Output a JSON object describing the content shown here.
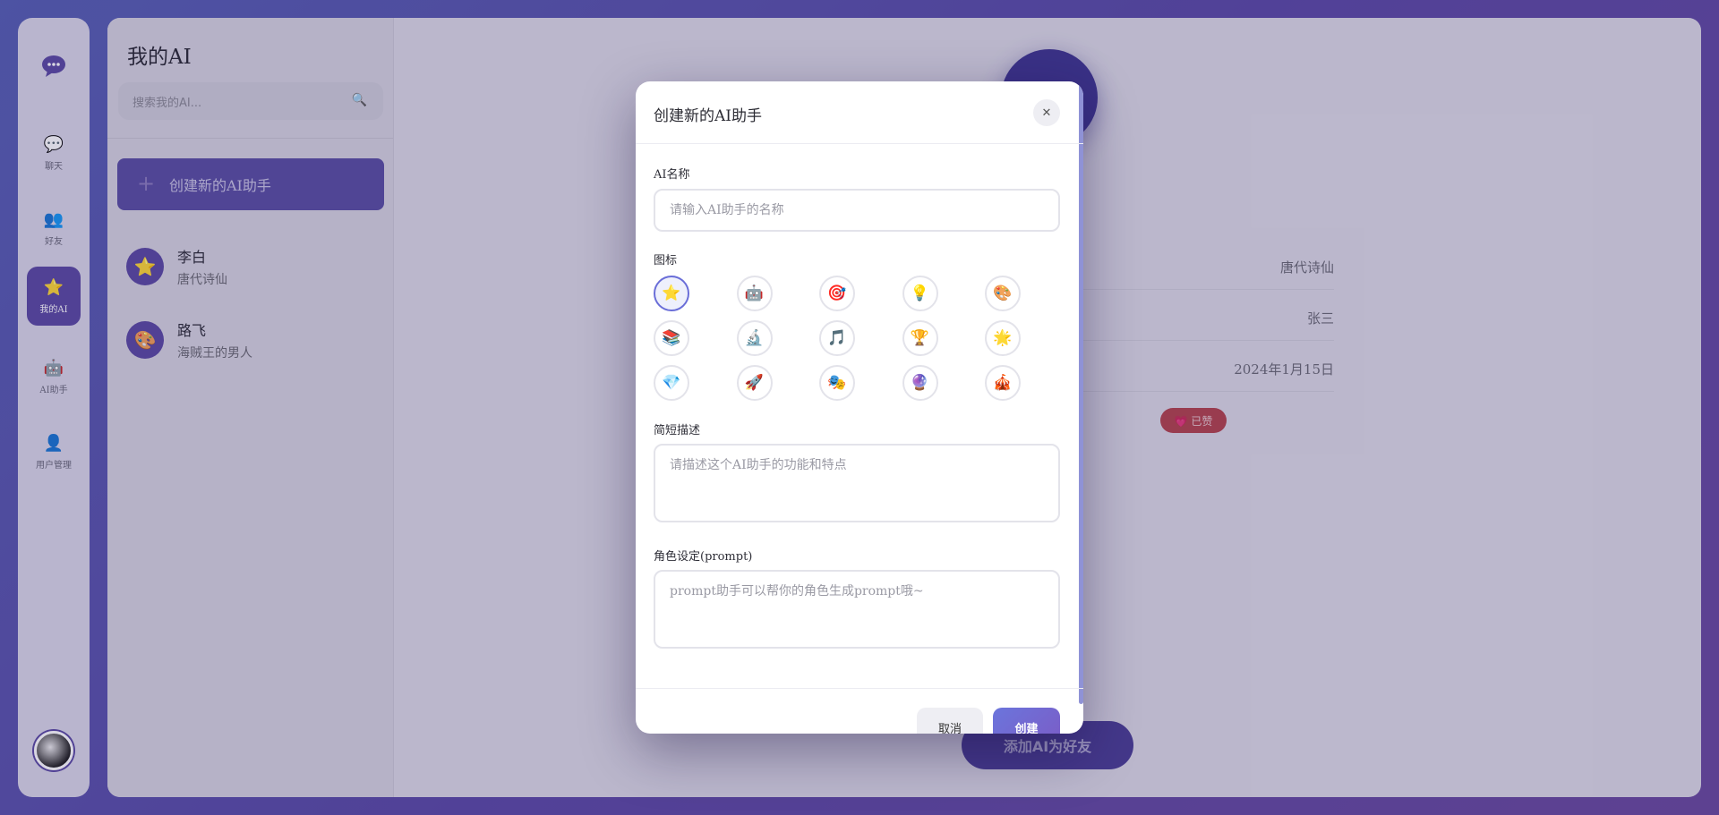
{
  "rail": {
    "logo_icon": "chat-bubble-icon",
    "items": [
      {
        "label": "聊天",
        "icon": "💬"
      },
      {
        "label": "好友",
        "icon": "👥"
      },
      {
        "label": "我的AI",
        "icon": "⭐"
      },
      {
        "label": "AI助手",
        "icon": "🤖"
      },
      {
        "label": "用户管理",
        "icon": "👤"
      }
    ],
    "active_index": 2
  },
  "sidebar": {
    "title": "我的AI",
    "search_placeholder": "搜索我的AI...",
    "create_label": "创建新的AI助手",
    "contacts": [
      {
        "name": "李白",
        "desc": "唐代诗仙",
        "icon": "⭐"
      },
      {
        "name": "路飞",
        "desc": "海贼王的男人",
        "icon": "🎨"
      }
    ]
  },
  "detail": {
    "rows": [
      "唐代诗仙",
      "张三",
      "2024年1月15日"
    ],
    "liked_label": "💗 已赞",
    "add_friend_label": "添加AI为好友"
  },
  "modal": {
    "title": "创建新的AI助手",
    "close_label": "✕",
    "name_label": "AI名称",
    "name_placeholder": "请输入AI助手的名称",
    "icon_label": "图标",
    "icons": [
      "⭐",
      "🤖",
      "🎯",
      "💡",
      "🎨",
      "📚",
      "🔬",
      "🎵",
      "🏆",
      "🌟",
      "💎",
      "🚀",
      "🎭",
      "🔮",
      "🎪"
    ],
    "selected_icon_index": 0,
    "desc_label": "简短描述",
    "desc_placeholder": "请描述这个AI助手的功能和特点",
    "prompt_label": "角色设定(prompt)",
    "prompt_placeholder": "prompt助手可以帮你的角色生成prompt哦~",
    "cancel_label": "取消",
    "create_label": "创建"
  }
}
